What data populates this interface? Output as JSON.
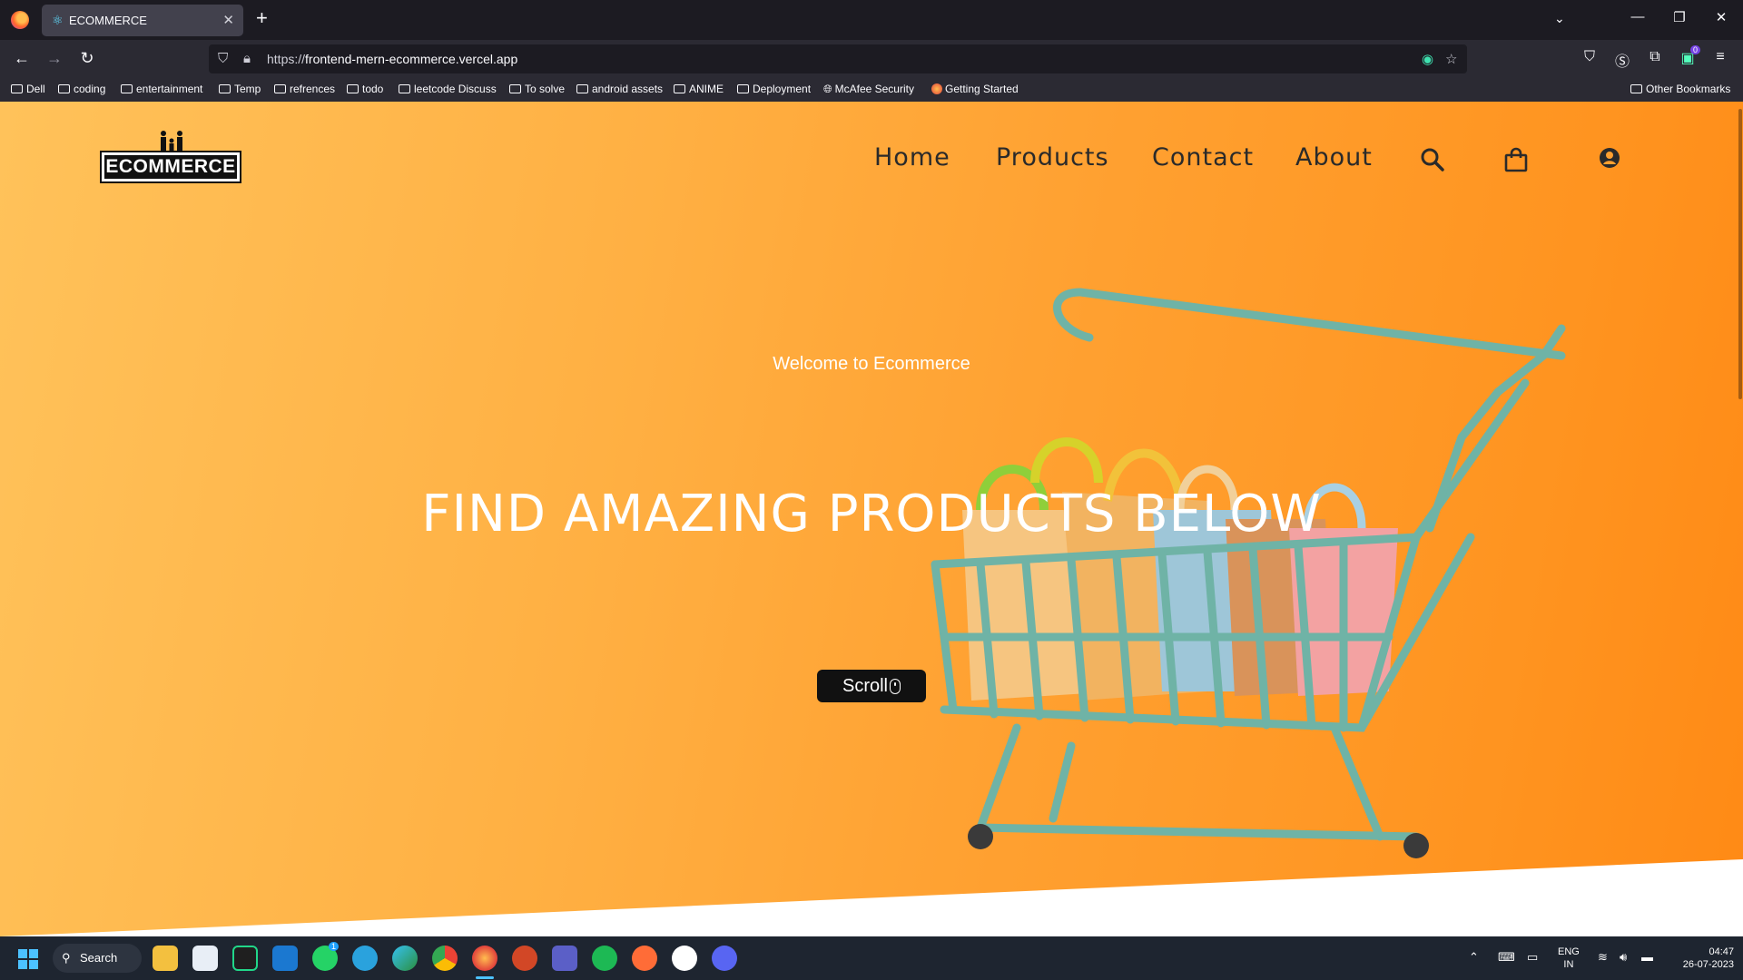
{
  "browser": {
    "tab_title": "ECOMMERCE",
    "url_scheme": "https://",
    "url_host": "frontend-mern-ecommerce.vercel.app",
    "extension_badge": "0"
  },
  "bookmarks": [
    {
      "label": "Dell",
      "icon": "folder-icon"
    },
    {
      "label": "coding",
      "icon": "folder-icon"
    },
    {
      "label": "entertainment",
      "icon": "folder-icon"
    },
    {
      "label": "Temp",
      "icon": "folder-icon"
    },
    {
      "label": "refrences",
      "icon": "folder-icon"
    },
    {
      "label": "todo",
      "icon": "folder-icon"
    },
    {
      "label": "leetcode Discuss",
      "icon": "folder-icon"
    },
    {
      "label": "To solve",
      "icon": "folder-icon"
    },
    {
      "label": "android assets",
      "icon": "folder-icon"
    },
    {
      "label": "ANIME",
      "icon": "folder-icon"
    },
    {
      "label": "Deployment",
      "icon": "folder-icon"
    },
    {
      "label": "McAfee Security",
      "icon": "globe-icon"
    },
    {
      "label": "Getting Started",
      "icon": "firefox-icon"
    }
  ],
  "other_bookmarks": "Other Bookmarks",
  "page": {
    "logo_text": "ECOMMERCE",
    "menu": [
      "Home",
      "Products",
      "Contact",
      "About"
    ],
    "welcome": "Welcome to Ecommerce",
    "headline": "FIND AMAZING PRODUCTS BELOW",
    "scroll_label": "Scroll"
  },
  "colors": {
    "hero_start": "#ffc25a",
    "hero_end": "#ff8a15",
    "cart_teal": "#6fb3a6",
    "button_bg": "#111111"
  },
  "taskbar": {
    "search_label": "Search",
    "whatsapp_badge": "1",
    "language_line1": "ENG",
    "language_line2": "IN",
    "time": "04:47",
    "date": "26-07-2023"
  }
}
